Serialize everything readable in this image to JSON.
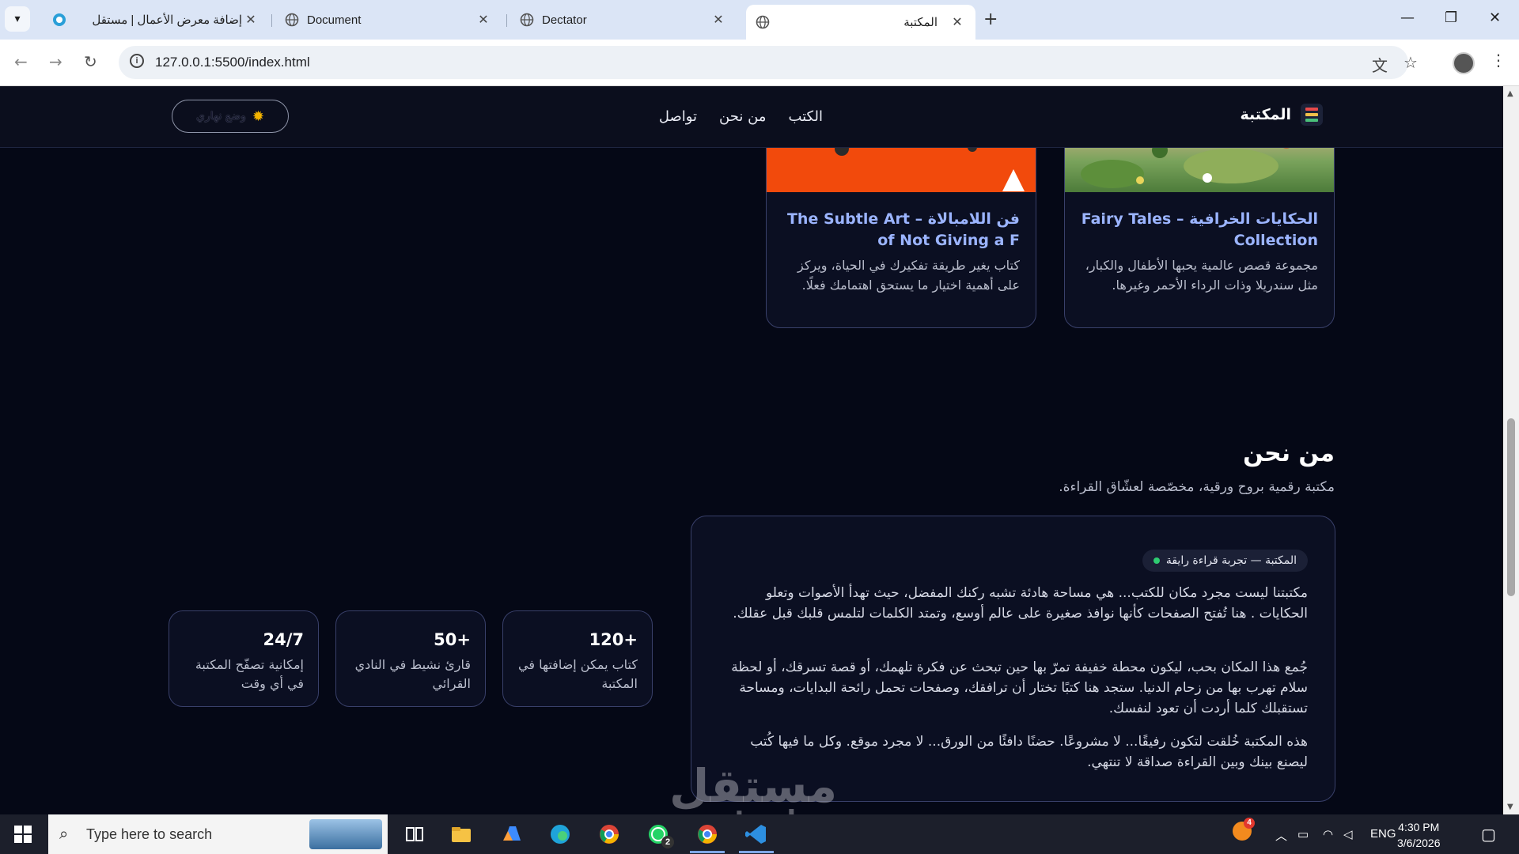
{
  "browser": {
    "tabs": [
      {
        "title": "إضافة معرض الأعمال | مستقل",
        "favicon": "mostaql-icon",
        "active": false
      },
      {
        "title": "Document",
        "favicon": "globe-icon",
        "active": false
      },
      {
        "title": "Dectator",
        "favicon": "globe-icon",
        "active": false
      },
      {
        "title": "المكتبة",
        "favicon": "globe-icon",
        "active": true
      }
    ],
    "url": "127.0.0.1:5500/index.html"
  },
  "site": {
    "brand": "المكتبة",
    "nav": [
      "الكتب",
      "من نحن",
      "تواصل"
    ],
    "mode_button": "وضع نهاري",
    "books": [
      {
        "title": "الحكايات الخرافية – Fairy Tales Collection",
        "desc": "مجموعة قصص عالمية يحبها الأطفال والكبار، مثل سندريلا وذات الرداء الأحمر وغيرها.",
        "cover": "fairy-tales-illustration"
      },
      {
        "title": "فن اللامبالاة – The Subtle Art of Not Giving a F",
        "desc": "كتاب يغير طريقة تفكيرك في الحياة، ويركز على أهمية اختيار ما يستحق اهتمامك فعلًا.",
        "cover": "orange-book-cover"
      }
    ],
    "about": {
      "title": "من نحن",
      "subtitle": "مكتبة رقمية بروح ورقية، مخصّصة لعشّاق القراءة.",
      "badge": "المكتبة — تجربة قراءة رايقة",
      "paragraphs": [
        "مكتبتنا ليست مجرد مكان للكتب... هي مساحة هادئة تشبه ركنك المفضل، حيث تهدأ الأصوات وتعلو الحكايات . هنا تُفتح الصفحات كأنها نوافذ صغيرة على عالم أوسع، وتمتد الكلمات لتلمس قلبك قبل عقلك.",
        "جُمع هذا المكان بحب، ليكون محطة خفيفة تمرّ بها حين تبحث عن فكرة تلهمك، أو قصة تسرقك، أو لحظة سلام تهرب بها من زحام الدنيا. ستجد هنا كتبًا تختار أن ترافقك، وصفحات تحمل رائحة البدايات، ومساحة تستقبلك كلما أردت أن تعود لنفسك.",
        "هذه المكتبة خُلقت لتكون رفيقًا... لا مشروعًا. حضنًا دافئًا من الورق... لا مجرد موقع. وكل ما فيها كُتب ليصنع بينك وبين القراءة صداقة لا تنتهي."
      ]
    },
    "stats": [
      {
        "num": "120+",
        "label": "كتاب يمكن إضافتها في المكتبة"
      },
      {
        "num": "50+",
        "label": "قارئ نشيط في النادي القرائي"
      },
      {
        "num": "24/7",
        "label": "إمكانية تصفّح المكتبة في أي وقت"
      }
    ],
    "watermark": {
      "ar": "مستقل",
      "en": "mostaql.com"
    }
  },
  "taskbar": {
    "search_placeholder": "Type here to search",
    "apps": [
      "task-view-icon",
      "file-explorer-icon",
      "copilot-icon",
      "edge-icon",
      "chrome-icon",
      "whatsapp-icon",
      "chrome-profile-icon",
      "vscode-icon"
    ],
    "whatsapp_badge": "2",
    "notif_badge": "4",
    "lang": "ENG",
    "time": "4:30 PM",
    "date": "3/6/2026"
  },
  "colors": {
    "accent_title": "#9bb4ff",
    "page_bg": "#050816",
    "card_border": "#39406a",
    "online_dot": "#2ecc71"
  }
}
